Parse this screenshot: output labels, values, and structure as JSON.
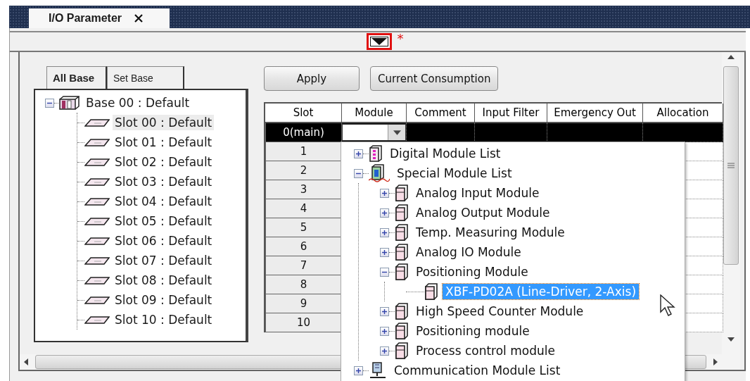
{
  "document_tab": {
    "title": "I/O Parameter",
    "selected": true
  },
  "toggle": {
    "marker": "*"
  },
  "base_tabs": [
    {
      "label": "All Base",
      "selected": true
    },
    {
      "label": "Set Base",
      "selected": false
    }
  ],
  "base_tree": {
    "label": "Base 00 : Default",
    "expanded": true,
    "children": [
      {
        "label": "Slot 00 : Default",
        "selected": true
      },
      {
        "label": "Slot 01 : Default",
        "selected": false
      },
      {
        "label": "Slot 02 : Default",
        "selected": false
      },
      {
        "label": "Slot 03 : Default",
        "selected": false
      },
      {
        "label": "Slot 04 : Default",
        "selected": false
      },
      {
        "label": "Slot 05 : Default",
        "selected": false
      },
      {
        "label": "Slot 06 : Default",
        "selected": false
      },
      {
        "label": "Slot 07 : Default",
        "selected": false
      },
      {
        "label": "Slot 08 : Default",
        "selected": false
      },
      {
        "label": "Slot 09 : Default",
        "selected": false
      },
      {
        "label": "Slot 10 : Default",
        "selected": false
      }
    ]
  },
  "buttons": [
    "Apply",
    "Current Consumption"
  ],
  "table": {
    "columns": [
      "Slot",
      "Module",
      "Comment",
      "Input Filter",
      "Emergency Out",
      "Allocation"
    ],
    "rows": [
      {
        "slot": "0(main)",
        "selected": true
      },
      {
        "slot": "1",
        "selected": false
      },
      {
        "slot": "2",
        "selected": false
      },
      {
        "slot": "3",
        "selected": false
      },
      {
        "slot": "4",
        "selected": false
      },
      {
        "slot": "5",
        "selected": false
      },
      {
        "slot": "6",
        "selected": false
      },
      {
        "slot": "7",
        "selected": false
      },
      {
        "slot": "8",
        "selected": false
      },
      {
        "slot": "9",
        "selected": false
      },
      {
        "slot": "10",
        "selected": false
      }
    ]
  },
  "module_dropdown": {
    "items": [
      {
        "label": "Digital Module List",
        "kind": "digital",
        "expanded": false
      },
      {
        "label": "Special Module List",
        "kind": "special",
        "expanded": true,
        "children": [
          {
            "label": "Analog Input Module",
            "kind": "module",
            "expanded": false
          },
          {
            "label": "Analog Output Module",
            "kind": "module",
            "expanded": false
          },
          {
            "label": "Temp. Measuring Module",
            "kind": "module",
            "expanded": false
          },
          {
            "label": "Analog IO Module",
            "kind": "module",
            "expanded": false
          },
          {
            "label": "Positioning Module",
            "kind": "module",
            "expanded": true,
            "children": [
              {
                "label": "XBF-PD02A (Line-Driver, 2-Axis)",
                "kind": "module",
                "selected": true
              }
            ]
          },
          {
            "label": "High Speed Counter Module",
            "kind": "module",
            "expanded": false
          },
          {
            "label": "Positioning module",
            "kind": "module",
            "expanded": false
          },
          {
            "label": "Process control module",
            "kind": "module",
            "expanded": false
          }
        ]
      },
      {
        "label": "Communication Module List",
        "kind": "communication",
        "expanded": false
      }
    ]
  }
}
